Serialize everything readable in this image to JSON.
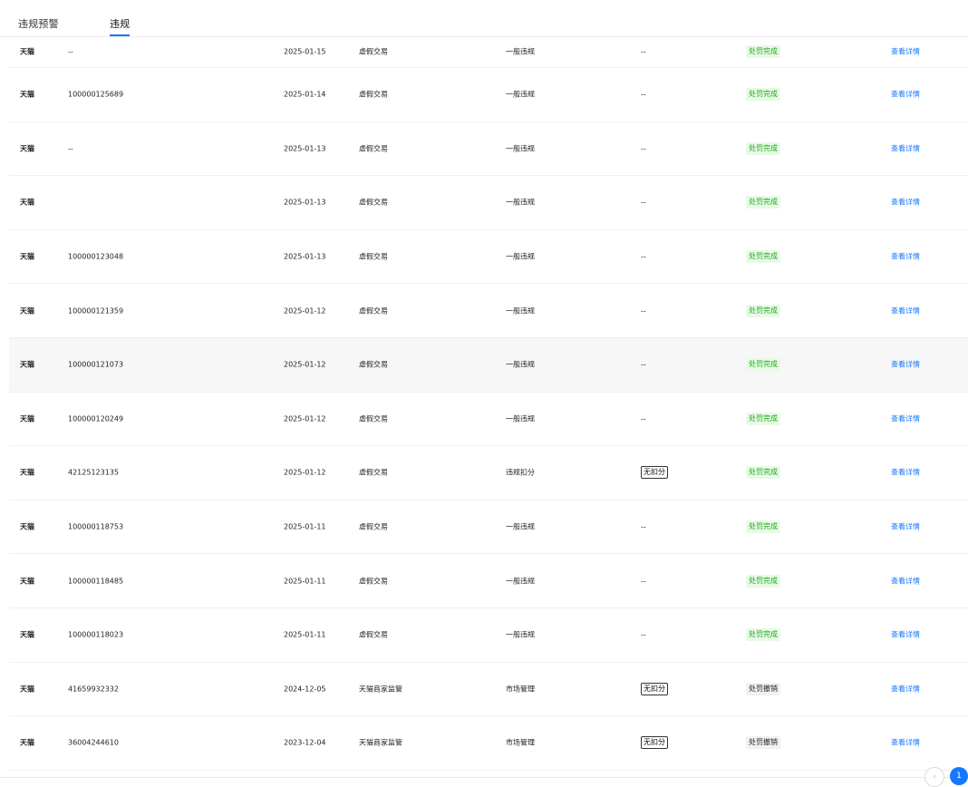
{
  "tabs": [
    {
      "label": "违规预警"
    },
    {
      "label": "违规"
    }
  ],
  "rows": [
    {
      "platform": "天猫",
      "id": "--",
      "date": "2025-01-15",
      "type": "虚假交易",
      "level": "一般违规",
      "deduct": "--",
      "status": "处罚完成",
      "action": "查看详情"
    },
    {
      "platform": "天猫",
      "id": "100000125689",
      "date": "2025-01-14",
      "type": "虚假交易",
      "level": "一般违规",
      "deduct": "--",
      "status": "处罚完成",
      "action": "查看详情"
    },
    {
      "platform": "天猫",
      "id": "--",
      "date": "2025-01-13",
      "type": "虚假交易",
      "level": "一般违规",
      "deduct": "--",
      "status": "处罚完成",
      "action": "查看详情"
    },
    {
      "platform": "天猫",
      "id": "",
      "date": "2025-01-13",
      "type": "虚假交易",
      "level": "一般违规",
      "deduct": "--",
      "status": "处罚完成",
      "action": "查看详情"
    },
    {
      "platform": "天猫",
      "id": "100000123048",
      "date": "2025-01-13",
      "type": "虚假交易",
      "level": "一般违规",
      "deduct": "--",
      "status": "处罚完成",
      "action": "查看详情"
    },
    {
      "platform": "天猫",
      "id": "100000121359",
      "date": "2025-01-12",
      "type": "虚假交易",
      "level": "一般违规",
      "deduct": "--",
      "status": "处罚完成",
      "action": "查看详情"
    },
    {
      "platform": "天猫",
      "id": "100000121073",
      "date": "2025-01-12",
      "type": "虚假交易",
      "level": "一般违规",
      "deduct": "--",
      "status": "处罚完成",
      "action": "查看详情"
    },
    {
      "platform": "天猫",
      "id": "100000120249",
      "date": "2025-01-12",
      "type": "虚假交易",
      "level": "一般违规",
      "deduct": "--",
      "status": "处罚完成",
      "action": "查看详情"
    },
    {
      "platform": "天猫",
      "id": "42125123135",
      "date": "2025-01-12",
      "type": "虚假交易",
      "level": "违规扣分",
      "deduct": "无扣分",
      "status": "处罚完成",
      "action": "查看详情"
    },
    {
      "platform": "天猫",
      "id": "100000118753",
      "date": "2025-01-11",
      "type": "虚假交易",
      "level": "一般违规",
      "deduct": "--",
      "status": "处罚完成",
      "action": "查看详情"
    },
    {
      "platform": "天猫",
      "id": "100000118485",
      "date": "2025-01-11",
      "type": "虚假交易",
      "level": "一般违规",
      "deduct": "--",
      "status": "处罚完成",
      "action": "查看详情"
    },
    {
      "platform": "天猫",
      "id": "100000118023",
      "date": "2025-01-11",
      "type": "虚假交易",
      "level": "一般违规",
      "deduct": "--",
      "status": "处罚完成",
      "action": "查看详情"
    },
    {
      "platform": "天猫",
      "id": "41659932332",
      "date": "2024-12-05",
      "type": "天猫商家监管",
      "level": "市场管理",
      "deduct": "无扣分",
      "status": "处罚撤销",
      "action": "查看详情"
    },
    {
      "platform": "天猫",
      "id": "36004244610",
      "date": "2023-12-04",
      "type": "天猫商家监管",
      "level": "市场管理",
      "deduct": "无扣分",
      "status": "处罚撤销",
      "action": "查看详情"
    }
  ],
  "pagination": {
    "prev": "‹",
    "current": "1"
  },
  "colors": {
    "accent": "#1677ff",
    "success_text": "#1aad19",
    "success_bg": "#e9f9e7"
  }
}
